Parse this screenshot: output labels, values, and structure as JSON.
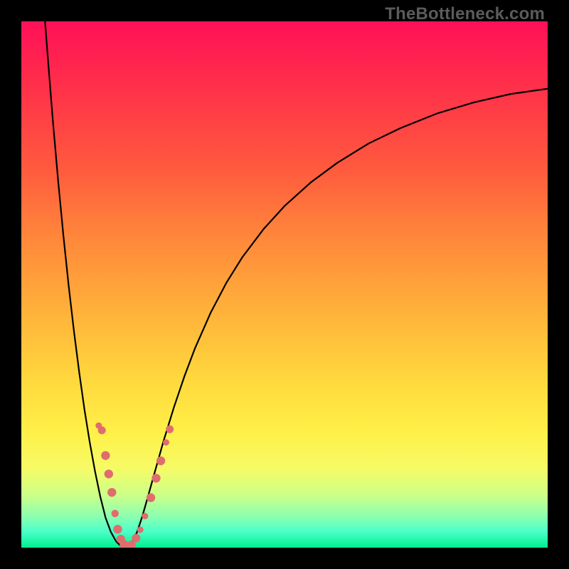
{
  "watermark": "TheBottleneck.com",
  "colors": {
    "frame": "#000000",
    "curve": "#000000",
    "marker_fill": "#e06d6d",
    "marker_stroke": "#b94a4a",
    "gradient_top": "#ff1058",
    "gradient_bottom": "#00ef8f"
  },
  "chart_data": {
    "type": "line",
    "title": "",
    "xlabel": "",
    "ylabel": "",
    "xlim": [
      0,
      100
    ],
    "ylim": [
      0,
      100
    ],
    "minimum_x": 20,
    "left_top_x": 4.5,
    "right_edge_y": 86,
    "series": [
      {
        "name": "bottleneck-curve",
        "x": [
          4.5,
          5,
          6,
          7,
          8,
          9,
          10,
          11,
          12,
          13,
          14,
          15,
          16,
          17,
          18,
          19,
          20,
          21,
          22,
          23,
          24,
          25,
          27,
          29,
          31,
          33,
          36,
          39,
          42,
          46,
          50,
          55,
          60,
          66,
          72,
          79,
          86,
          93,
          100
        ],
        "y": [
          100,
          93.5,
          81.0,
          69.6,
          59.2,
          49.7,
          41.1,
          33.3,
          26.2,
          20.0,
          14.5,
          9.7,
          5.7,
          3.0,
          1.2,
          0.2,
          0.0,
          0.9,
          3.0,
          6.0,
          9.5,
          13.1,
          20.2,
          26.7,
          32.6,
          37.9,
          44.7,
          50.4,
          55.2,
          60.5,
          64.9,
          69.4,
          73.1,
          76.8,
          79.7,
          82.5,
          84.6,
          86.2,
          87.2
        ]
      }
    ],
    "markers": [
      {
        "x": 15.3,
        "y": 22.3,
        "r": 5.5
      },
      {
        "x": 14.7,
        "y": 23.2,
        "r": 4.5
      },
      {
        "x": 16.0,
        "y": 17.5,
        "r": 6.2
      },
      {
        "x": 16.6,
        "y": 14.0,
        "r": 6.2
      },
      {
        "x": 17.2,
        "y": 10.5,
        "r": 6.2
      },
      {
        "x": 17.8,
        "y": 6.5,
        "r": 5.2
      },
      {
        "x": 18.3,
        "y": 3.5,
        "r": 6.2
      },
      {
        "x": 18.9,
        "y": 1.6,
        "r": 6.2
      },
      {
        "x": 19.5,
        "y": 0.6,
        "r": 6.2
      },
      {
        "x": 20.0,
        "y": 0.2,
        "r": 5.0
      },
      {
        "x": 20.9,
        "y": 0.5,
        "r": 6.2
      },
      {
        "x": 21.8,
        "y": 1.8,
        "r": 6.0
      },
      {
        "x": 22.6,
        "y": 3.4,
        "r": 4.5
      },
      {
        "x": 23.5,
        "y": 6.0,
        "r": 4.5
      },
      {
        "x": 24.6,
        "y": 9.5,
        "r": 6.2
      },
      {
        "x": 25.6,
        "y": 13.2,
        "r": 6.2
      },
      {
        "x": 26.5,
        "y": 16.5,
        "r": 6.2
      },
      {
        "x": 27.5,
        "y": 20.0,
        "r": 4.5
      },
      {
        "x": 28.2,
        "y": 22.5,
        "r": 5.5
      }
    ]
  }
}
